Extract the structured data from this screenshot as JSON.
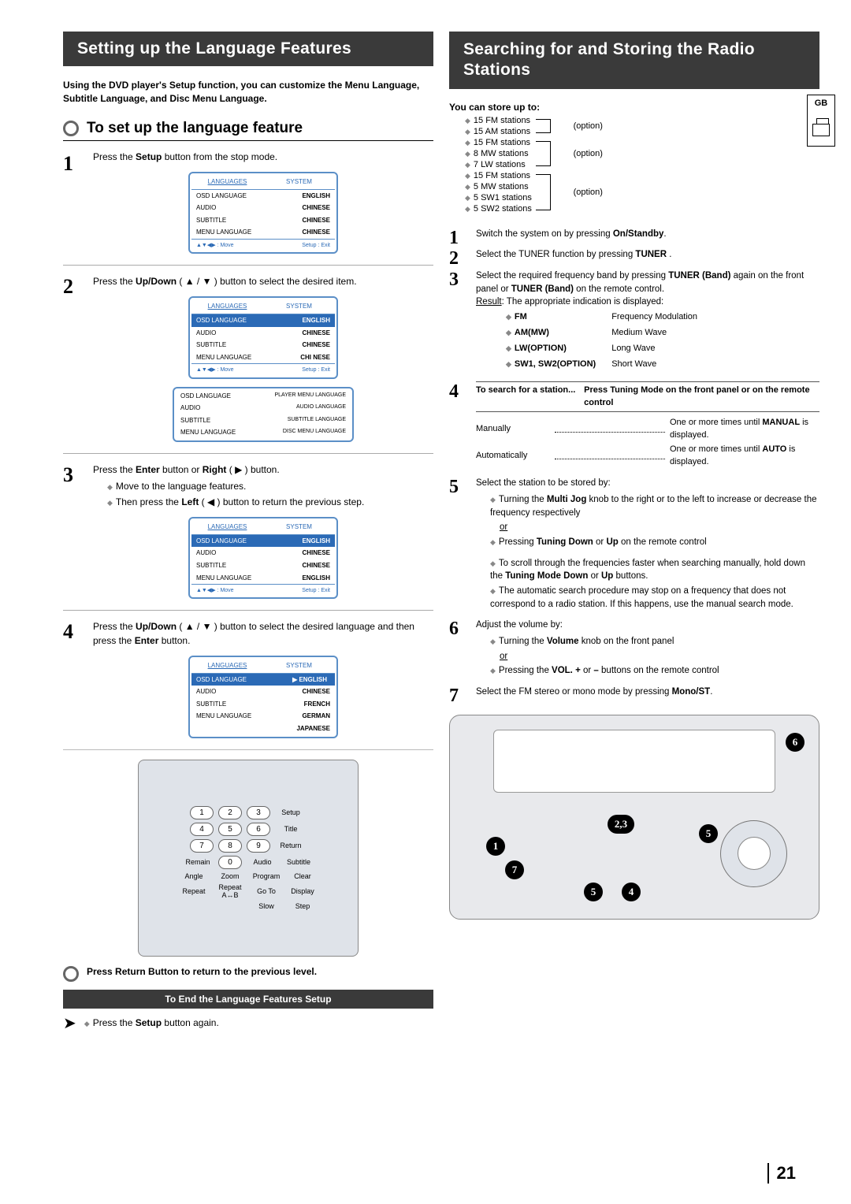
{
  "page_number": "21",
  "gb_badge": "GB",
  "left": {
    "heading": "Setting up the Language Features",
    "intro": "Using the DVD player's Setup function, you can customize the Menu Language, Subtitle Language, and Disc Menu Language.",
    "sub_heading": "To set up the language feature",
    "steps": {
      "s1": {
        "text_a": "Press the ",
        "bold_a": "Setup",
        "text_b": " button from the stop mode."
      },
      "s2": {
        "text_a": "Press the ",
        "bold_a": "Up/Down",
        "text_b": " ( ▲ / ▼ ) button  to select the desired item."
      },
      "s3": {
        "line1_a": "Press the ",
        "line1_bold1": "Enter",
        "line1_b": " button or ",
        "line1_bold2": "Right",
        "line1_c": " ( ▶ ) button.",
        "d1": "Move to the language features.",
        "d2_a": "Then press the ",
        "d2_bold": "Left",
        "d2_b": " ( ◀ ) button to return the previous step."
      },
      "s4": {
        "text_a": "Press the ",
        "bold_a": "Up/Down",
        "text_b": " ( ▲ / ▼ ) button to select the desired language and then press the ",
        "bold_b": "Enter",
        "text_c": " button."
      }
    },
    "menu": {
      "tabs": {
        "languages": "LANGUAGES",
        "system": "SYSTEM"
      },
      "rows1": [
        {
          "k": "OSD LANGUAGE",
          "v": "ENGLISH"
        },
        {
          "k": "AUDIO",
          "v": "CHINESE"
        },
        {
          "k": "SUBTITLE",
          "v": "CHINESE"
        },
        {
          "k": "MENU LANGUAGE",
          "v": "CHINESE"
        }
      ],
      "rows2a": [
        {
          "k": "OSD LANGUAGE",
          "v": "ENGLISH"
        },
        {
          "k": "AUDIO",
          "v": "CHINESE"
        },
        {
          "k": "SUBTITLE",
          "v": "CHINESE"
        },
        {
          "k": "MENU LANGUAGE",
          "v": "CHI NESE"
        }
      ],
      "rows2b": [
        {
          "k": "OSD LANGUAGE",
          "v": "PLAYER MENU LANGUAGE"
        },
        {
          "k": "AUDIO",
          "v": "AUDIO LANGUAGE"
        },
        {
          "k": "SUBTITLE",
          "v": "SUBTITLE LANGUAGE"
        },
        {
          "k": "MENU LANGUAGE",
          "v": "DISC MENU LANGUAGE"
        }
      ],
      "rows3": [
        {
          "k": "OSD LANGUAGE",
          "v": "ENGLISH"
        },
        {
          "k": "AUDIO",
          "v": "CHINESE"
        },
        {
          "k": "SUBTITLE",
          "v": "CHINESE"
        },
        {
          "k": "MENU LANGUAGE",
          "v": "ENGLISH"
        }
      ],
      "rows4": [
        {
          "k": "OSD LANGUAGE",
          "v": "▶ ENGLISH"
        },
        {
          "k": "AUDIO",
          "v": "CHINESE"
        },
        {
          "k": "SUBTITLE",
          "v": "FRENCH"
        },
        {
          "k": "MENU LANGUAGE",
          "v": "GERMAN"
        },
        {
          "k": "",
          "v": "JAPANESE"
        }
      ],
      "foot_left": "▲▼◀▶ : Move",
      "foot_right": "Setup : Exit"
    },
    "remote": {
      "labels": {
        "setup": "Setup",
        "title": "Title",
        "return": "Return",
        "remain": "Remain",
        "audio": "Audio",
        "subtitle": "Subtitle",
        "angle": "Angle",
        "zoom": "Zoom",
        "program": "Program",
        "clear": "Clear",
        "repeat": "Repeat",
        "repeat_ab": "Repeat A↔B",
        "goto": "Go To",
        "display": "Display",
        "slow": "Slow",
        "step": "Step"
      },
      "nums": [
        "1",
        "2",
        "3",
        "4",
        "5",
        "6",
        "7",
        "8",
        "9",
        "0"
      ]
    },
    "return_note": "Press Return Button to  return to the previous level.",
    "end_band": "To End the Language Features Setup",
    "end_text_a": "Press the ",
    "end_bold": "Setup",
    "end_text_b": " button again."
  },
  "right": {
    "heading": "Searching for and Storing the Radio Stations",
    "store_head": "You can store up to:",
    "option_label": "(option)",
    "stations": {
      "g1": [
        "15 FM stations",
        "15 AM stations"
      ],
      "g2": [
        "15 FM stations",
        "8 MW stations",
        "7 LW stations"
      ],
      "g3": [
        "15 FM stations",
        "5 MW stations",
        "5 SW1 stations",
        "5 SW2 stations"
      ]
    },
    "steps": {
      "s1_a": "Switch the system on by pressing ",
      "s1_bold": "On/Standby",
      "s1_b": ".",
      "s2_a": "Select the TUNER function by pressing ",
      "s2_bold": "TUNER",
      "s2_b": " .",
      "s3": {
        "a": "Select the required frequency band by pressing ",
        "bold1": "TUNER (Band)",
        "b": " again on the front panel or ",
        "bold2": "TUNER (Band)",
        "c": " on the remote control.",
        "res_lead": "Result",
        "res_text": ": The appropriate indication is displayed:",
        "bands": [
          {
            "k": "FM",
            "v": "Frequency Modulation"
          },
          {
            "k": "AM(MW)",
            "v": "Medium Wave"
          },
          {
            "k": "LW(OPTION)",
            "v": "Long Wave"
          },
          {
            "k": "SW1, SW2(OPTION)",
            "v": "Short Wave"
          }
        ]
      },
      "s4": {
        "col1": "To search for a station...",
        "col2": "Press Tuning Mode on the front panel or  on the remote control",
        "man_lbl": "Manually",
        "man_txt_a": "One or more times until ",
        "man_bold": "MANUAL",
        "man_txt_b": " is displayed.",
        "auto_lbl": "Automatically",
        "auto_txt_a": "One or more times until ",
        "auto_bold": "AUTO",
        "auto_txt_b": "  is displayed."
      },
      "s5": {
        "intro": "Select the station to be stored by:",
        "d1_a": "Turning the ",
        "d1_bold": "Multi Jog",
        "d1_b": " knob to the right or to the left to increase or decrease the frequency respectively",
        "or": "or",
        "d2_a": "Pressing ",
        "d2_bold": "Tuning Down",
        "d2_b": " or ",
        "d2_bold2": "Up",
        "d2_c": " on the remote control",
        "d3_a": "To scroll through the frequencies faster when searching manually, hold down the ",
        "d3_bold": "Tuning Mode Down",
        "d3_b": " or ",
        "d3_bold2": "Up",
        "d3_c": " buttons.",
        "d4": "The automatic search procedure may stop on a frequency that does not correspond to a radio station. If this happens, use the manual search mode."
      },
      "s6": {
        "intro": "Adjust the volume by:",
        "d1_a": "Turning the ",
        "d1_bold": "Volume",
        "d1_b": " knob on the front panel",
        "or": "or",
        "d2_a": "Pressing the ",
        "d2_bold": "VOL. +",
        "d2_b": " or ",
        "d2_bold2": "–",
        "d2_c": " buttons on the remote control"
      },
      "s7_a": "Select the FM stereo or mono mode by pressing ",
      "s7_bold": "Mono/ST",
      "s7_b": "."
    },
    "callouts": {
      "c1": "1",
      "c23": "2,3",
      "c4": "4",
      "c5": "5",
      "c6": "6",
      "c7": "7"
    }
  }
}
